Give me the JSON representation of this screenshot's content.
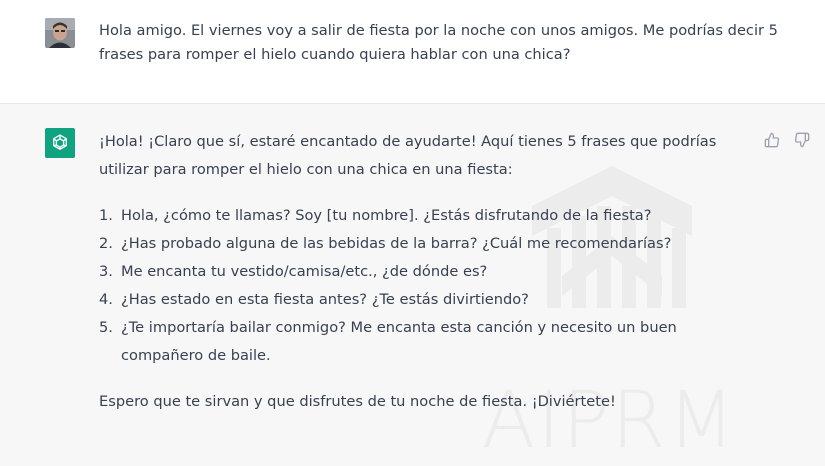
{
  "user_message": {
    "text": "Hola amigo. El viernes voy a salir de fiesta por la noche con unos amigos. Me podrías decir 5 frases para romper el hielo cuando quiera hablar con una chica?"
  },
  "assistant_message": {
    "intro": "¡Hola! ¡Claro que sí, estaré encantado de ayudarte! Aquí tienes 5 frases que podrías utilizar para romper el hielo con una chica en una fiesta:",
    "items": [
      {
        "num": "1.",
        "text": "Hola, ¿cómo te llamas? Soy [tu nombre]. ¿Estás disfrutando de la fiesta?"
      },
      {
        "num": "2.",
        "text": "¿Has probado alguna de las bebidas de la barra? ¿Cuál me recomendarías?"
      },
      {
        "num": "3.",
        "text": "Me encanta tu vestido/camisa/etc., ¿de dónde es?"
      },
      {
        "num": "4.",
        "text": "¿Has estado en esta fiesta antes? ¿Te estás divirtiendo?"
      },
      {
        "num": "5.",
        "text": "¿Te importaría bailar conmigo? Me encanta esta canción y necesito un buen compañero de baile."
      }
    ],
    "closing": "Espero que te sirvan y que disfrutes de tu noche de fiesta. ¡Diviértete!"
  },
  "watermark": {
    "text": "AIPRM"
  },
  "icons": {
    "user_avatar": "user-photo-avatar",
    "assistant_avatar": "openai-logo-icon",
    "thumbs_up": "thumbs-up-icon",
    "thumbs_down": "thumbs-down-icon"
  },
  "colors": {
    "assistant_bg": "#f7f7f8",
    "user_bg": "#ffffff",
    "gpt_green": "#10a37f",
    "text": "#374151"
  }
}
